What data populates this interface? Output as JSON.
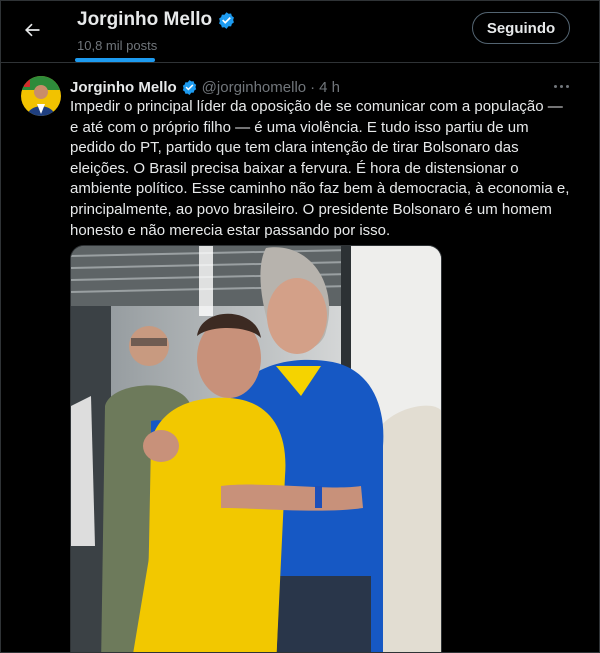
{
  "header": {
    "title": "Jorginho Mello",
    "subtitle": "10,8 mil posts",
    "follow_label": "Seguindo"
  },
  "tweet": {
    "name": "Jorginho Mello",
    "handle": "@jorginhomello",
    "separator": "·",
    "time": "4 h",
    "lines": [
      "Impedir o principal líder da oposição de se comunicar com a população —",
      "e até com o próprio filho — é uma violência. E tudo isso partiu de um",
      "pedido do PT, partido que tem clara intenção de tirar Bolsonaro das",
      "eleições. O Brasil precisa baixar a fervura. É hora de distensionar o",
      "ambiente político. Esse caminho não faz bem à democracia, à economia e,",
      "principalmente, ao povo brasileiro. O presidente Bolsonaro é um homem",
      "honesto e não merecia estar passando por isso."
    ]
  },
  "colors": {
    "background": "#000000",
    "text": "#e7e9ea",
    "muted": "#71767b",
    "accent": "#1d9bf0",
    "border": "#2f3336"
  },
  "icons": {
    "back": "arrow-left-icon",
    "verified": "verified-badge-icon",
    "more": "more-horizontal-icon"
  }
}
